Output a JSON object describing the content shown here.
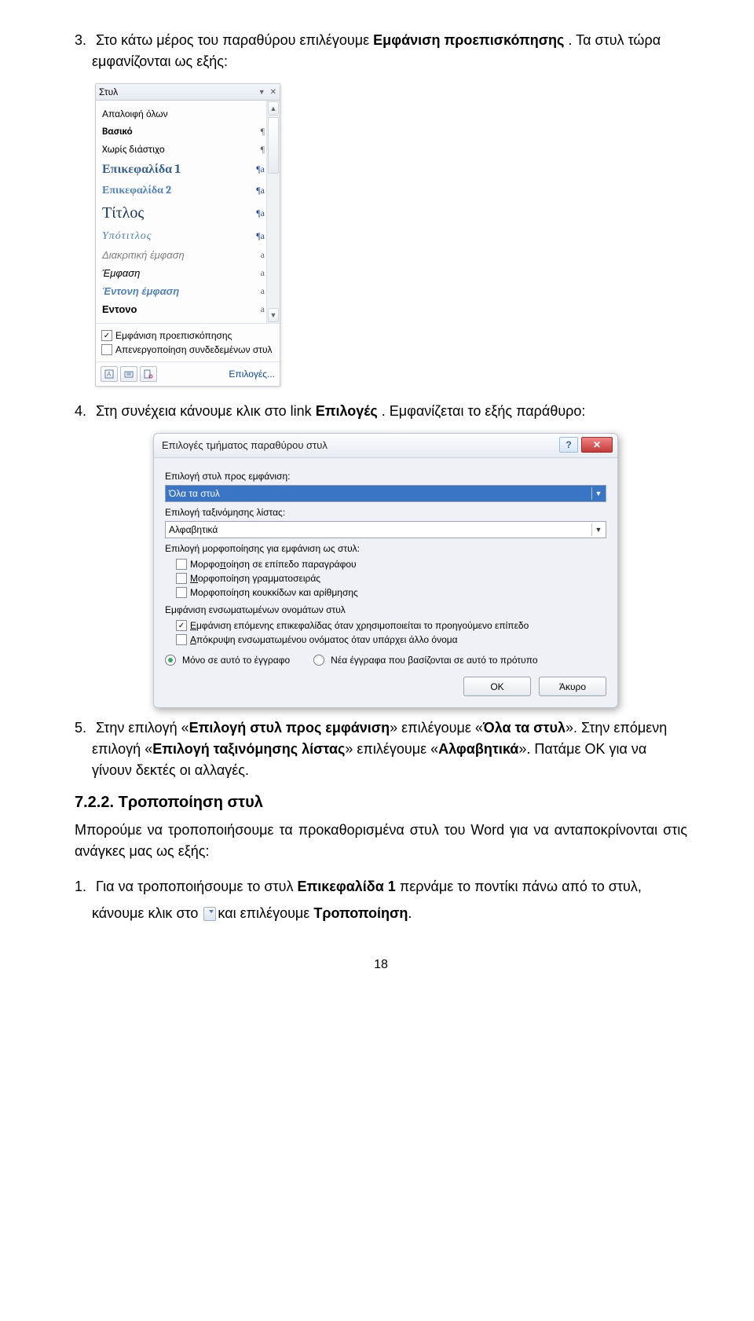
{
  "para3": {
    "num": "3.",
    "pre": "Στο κάτω μέρος του παραθύρου επιλέγουμε ",
    "bold": "Εμφάνιση προεπισκόπησης",
    "post": ". Τα στυλ τώρα εμφανίζονται ως εξής:"
  },
  "styles_pane": {
    "title": "Στυλ",
    "items": [
      {
        "label": "Απαλοιφή όλων",
        "cls": "",
        "sym": ""
      },
      {
        "label": "Βασικό",
        "cls": "st-basic",
        "sym": "¶"
      },
      {
        "label": "Χωρίς διάστιχο",
        "cls": "st-nosp",
        "sym": "¶"
      },
      {
        "label": "Επικεφαλίδα 1",
        "cls": "st-h1",
        "sym": "¶a"
      },
      {
        "label": "Επικεφαλίδα 2",
        "cls": "st-h2",
        "sym": "¶a"
      },
      {
        "label": "Τίτλος",
        "cls": "st-title",
        "sym": "¶a"
      },
      {
        "label": "Υπότιτλος",
        "cls": "st-sub",
        "sym": "¶a"
      },
      {
        "label": "Διακριτική έμφαση",
        "cls": "st-subtle",
        "sym": "a"
      },
      {
        "label": "Έμφαση",
        "cls": "st-emph",
        "sym": "a"
      },
      {
        "label": "Έντονη έμφαση",
        "cls": "st-int",
        "sym": "a"
      },
      {
        "label": "Εντονο",
        "cls": "st-strong",
        "sym": "a"
      }
    ],
    "chk_preview": "Εμφάνιση προεπισκόπησης",
    "chk_disable": "Απενεργοποίηση συνδεδεμένων στυλ",
    "options_link": "Επιλογές..."
  },
  "para4": {
    "num": "4.",
    "pre": "Στη συνέχεια κάνουμε κλικ στο link ",
    "bold": "Επιλογές",
    "post": ". Εμφανίζεται το εξής παράθυρο:"
  },
  "dlg": {
    "title": "Επιλογές τμήματος παραθύρου στυλ",
    "lbl_show": "Επιλογή στυλ προς εμφάνιση:",
    "combo_show": "Όλα τα στυλ",
    "lbl_sort": "Επιλογή ταξινόμησης λίστας:",
    "combo_sort": "Αλφαβητικά",
    "lbl_fmt": "Επιλογή μορφοποίησης για εμφάνιση ως στυλ:",
    "fmt1_u": "π",
    "fmt1": "Μορφοποίηση σε επίπεδο παραγράφου",
    "fmt2_u": "Μ",
    "fmt2": "ορφοποίηση γραμματοσειράς",
    "fmt3": "Μορφοποίηση κουκκίδων και αρίθμησης",
    "lbl_builtin": "Εμφάνιση ενσωματωμένων ονομάτων στυλ",
    "b1_u": "Ε",
    "b1": "μφάνιση επόμενης επικεφαλίδας όταν χρησιμοποιείται το προηγούμενο επίπεδο",
    "b2_u": "Α",
    "b2": "πόκρυψη ενσωματωμένου ονόματος όταν υπάρχει άλλο όνομα",
    "radio1": "Μόνο σε αυτό το έγγραφο",
    "radio2": "Νέα έγγραφα που βασίζονται σε αυτό το πρότυπο",
    "ok": "OK",
    "cancel": "Άκυρο"
  },
  "para5": {
    "num": "5.",
    "pre": "Στην επιλογή «",
    "bold1": "Επιλογή στυλ προς εμφάνιση",
    "mid1": "» επιλέγουμε «",
    "bold2": "Όλα τα στυλ",
    "mid2": "». Στην επόμενη επιλογή «",
    "bold3": "Επιλογή ταξινόμησης λίστας",
    "mid3": "» επιλέγουμε «",
    "bold4": "Αλφαβητικά",
    "post": "». Πατάμε OK για να γίνουν δεκτές οι αλλαγές."
  },
  "heading722": "7.2.2. Τροποποίηση στυλ",
  "paraM": "Μπορούμε να τροποποιήσουμε τα προκαθορισμένα στυλ του Word για να ανταποκρίνονται στις ανάγκες μας ως εξής:",
  "item1": {
    "num": "1.",
    "pre": "Για να τροποποιήσουμε το στυλ ",
    "bold1": "Επικεφαλίδα 1",
    "mid1": " περνάμε το ποντίκι πάνω από το στυλ, κάνουμε κλικ στο ",
    "mid2": "και επιλέγουμε ",
    "bold2": "Τροποποίηση",
    "post": "."
  },
  "page_number": "18"
}
